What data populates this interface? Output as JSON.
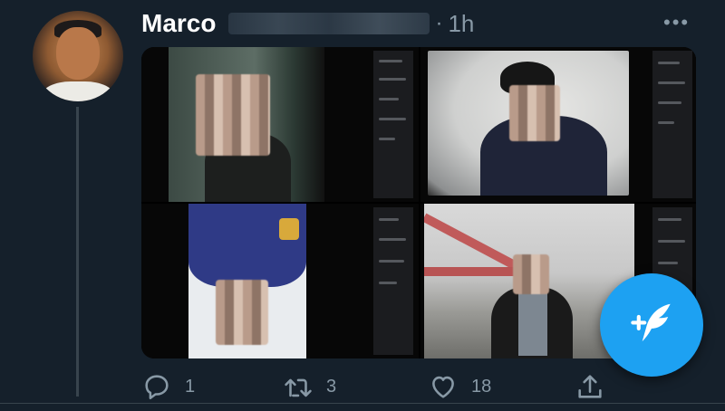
{
  "tweet": {
    "author_name": "Marco",
    "separator": "·",
    "time": "1h",
    "more_icon": "more-horizontal-icon",
    "more_text": "•••"
  },
  "media": {
    "count": 4,
    "blurred_faces": true
  },
  "actions": {
    "reply": {
      "icon": "reply-icon",
      "count": "1"
    },
    "retweet": {
      "icon": "retweet-icon",
      "count": "3"
    },
    "like": {
      "icon": "heart-icon",
      "count": "18"
    },
    "share": {
      "icon": "share-icon",
      "count": ""
    }
  },
  "compose": {
    "icon": "compose-tweet-icon"
  },
  "colors": {
    "background": "#15202b",
    "text_secondary": "#8899a6",
    "accent": "#1da1f2",
    "divider": "#38444d"
  }
}
